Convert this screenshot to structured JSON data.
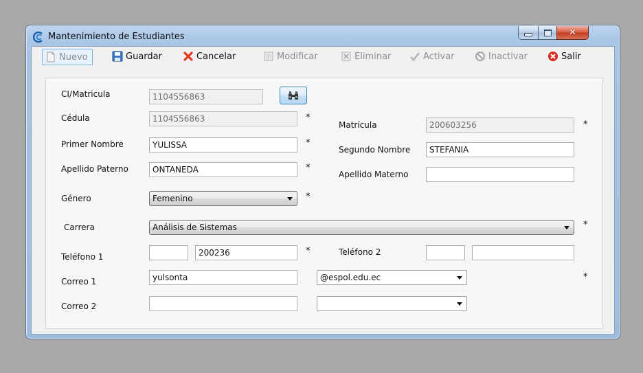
{
  "window": {
    "title": "Mantenimiento de Estudiantes"
  },
  "toolbar": {
    "nuevo": "Nuevo",
    "guardar": "Guardar",
    "cancelar": "Cancelar",
    "modificar": "Modificar",
    "eliminar": "Eliminar",
    "activar": "Activar",
    "inactivar": "Inactivar",
    "salir": "Salir"
  },
  "form": {
    "ci_label": "CI/Matricula",
    "ci_value": "1104556863",
    "cedula_label": "Cédula",
    "cedula_value": "1104556863",
    "matricula_label": "Matrícula",
    "matricula_value": "200603256",
    "primer_nombre_label": "Primer Nombre",
    "primer_nombre_value": "YULISSA",
    "segundo_nombre_label": "Segundo Nombre",
    "segundo_nombre_value": "STEFANIA",
    "apellido_paterno_label": "Apellido Paterno",
    "apellido_paterno_value": "ONTANEDA",
    "apellido_materno_label": "Apellido Materno",
    "apellido_materno_value": "",
    "genero_label": "Género",
    "genero_value": "Femenino",
    "carrera_label": "Carrera",
    "carrera_value": "Análisis de Sistemas",
    "telefono1_label": "Teléfono 1",
    "telefono1_code": "",
    "telefono1_value": "200236",
    "telefono2_label": "Teléfono 2",
    "telefono2_code": "",
    "telefono2_value": "",
    "correo1_label": "Correo 1",
    "correo1_user": "yulsonta",
    "correo1_domain": "@espol.edu.ec",
    "correo2_label": "Correo 2",
    "correo2_user": "",
    "correo2_domain": "",
    "required_mark": "*"
  },
  "icons": {
    "app": "app-logo-icon",
    "nuevo": "new-document-icon",
    "guardar": "floppy-disk-icon",
    "cancelar": "red-x-icon",
    "modificar": "edit-document-icon",
    "eliminar": "delete-document-icon",
    "activar": "checkmark-icon",
    "inactivar": "disabled-circle-icon",
    "salir": "red-circle-x-icon",
    "buscar": "binoculars-icon"
  },
  "colors": {
    "desktop": "#a9a9a9",
    "title_gradient": "#a9c6e6",
    "close_red": "#d7563b",
    "disabled_text": "#8d8d8d"
  }
}
